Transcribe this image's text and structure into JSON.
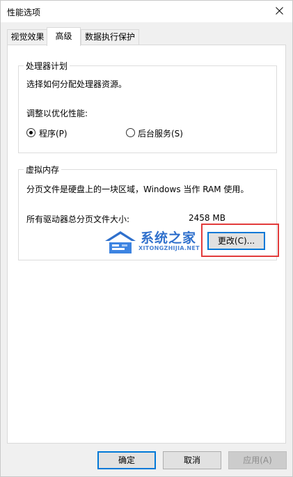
{
  "window": {
    "title": "性能选项"
  },
  "tabs": [
    {
      "label": "视觉效果",
      "active": false
    },
    {
      "label": "高级",
      "active": true
    },
    {
      "label": "数据执行保护",
      "active": false
    }
  ],
  "processor_scheduling": {
    "title": "处理器计划",
    "description": "选择如何分配处理器资源。",
    "adjust_label": "调整以优化性能:",
    "options": [
      {
        "label": "程序(P)",
        "selected": true
      },
      {
        "label": "后台服务(S)",
        "selected": false
      }
    ]
  },
  "virtual_memory": {
    "title": "虚拟内存",
    "description": "分页文件是硬盘上的一块区域，Windows 当作 RAM 使用。",
    "total_label": "所有驱动器总分页文件大小:",
    "total_value": "2458 MB",
    "change_button": "更改(C)..."
  },
  "watermark": {
    "name": "系统之家",
    "url": "XITONGZHIJIA.NET"
  },
  "footer": {
    "ok": "确定",
    "cancel": "取消",
    "apply": "应用(A)"
  },
  "colors": {
    "highlight": "#e23b3b",
    "focus": "#0078d7"
  }
}
